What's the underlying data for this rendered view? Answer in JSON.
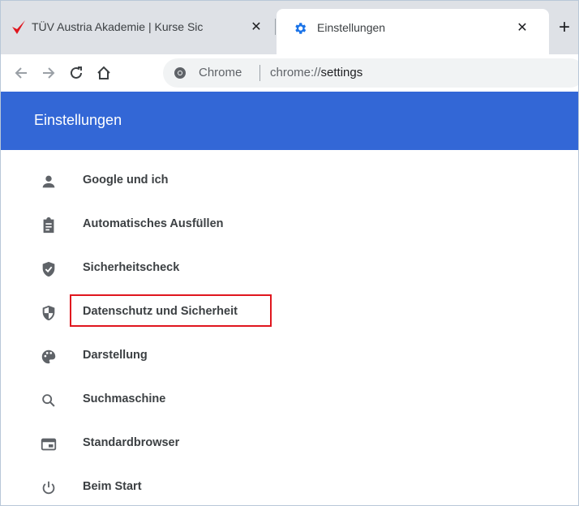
{
  "browser": {
    "tabs": [
      {
        "title": "TÜV Austria Akademie | Kurse Sic",
        "favicon": "tuv-check-logo",
        "close_label": "✕"
      },
      {
        "title": "Einstellungen",
        "favicon": "gear-icon",
        "close_label": "✕",
        "active": true
      }
    ],
    "new_tab_label": "+",
    "omnibox": {
      "chip": "Chrome",
      "url_scheme": "chrome://",
      "url_host": "settings"
    }
  },
  "settings": {
    "header_title": "Einstellungen",
    "accent_color": "#3367d6",
    "nav_items": [
      {
        "label": "Google und ich",
        "icon": "person-icon"
      },
      {
        "label": "Automatisches Ausfüllen",
        "icon": "clipboard-icon"
      },
      {
        "label": "Sicherheitscheck",
        "icon": "shield-check-icon"
      },
      {
        "label": "Datenschutz und Sicherheit",
        "icon": "shield-half-icon",
        "highlighted": true
      },
      {
        "label": "Darstellung",
        "icon": "palette-icon"
      },
      {
        "label": "Suchmaschine",
        "icon": "search-icon"
      },
      {
        "label": "Standardbrowser",
        "icon": "browser-window-icon"
      },
      {
        "label": "Beim Start",
        "icon": "power-icon"
      }
    ]
  },
  "annotation": {
    "highlight_color": "#e0161e"
  }
}
